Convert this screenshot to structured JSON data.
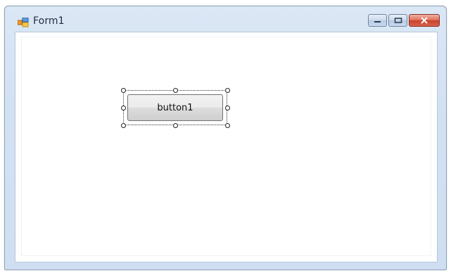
{
  "window": {
    "title": "Form1",
    "icon": "form-icon"
  },
  "controls": {
    "minimize_icon": "minimize-icon",
    "maximize_icon": "maximize-icon",
    "close_icon": "close-icon"
  },
  "form": {
    "button_label": "button1"
  },
  "colors": {
    "titlebar": "#d2e1f2",
    "close": "#c9412b",
    "border": "#8ea3bd"
  }
}
